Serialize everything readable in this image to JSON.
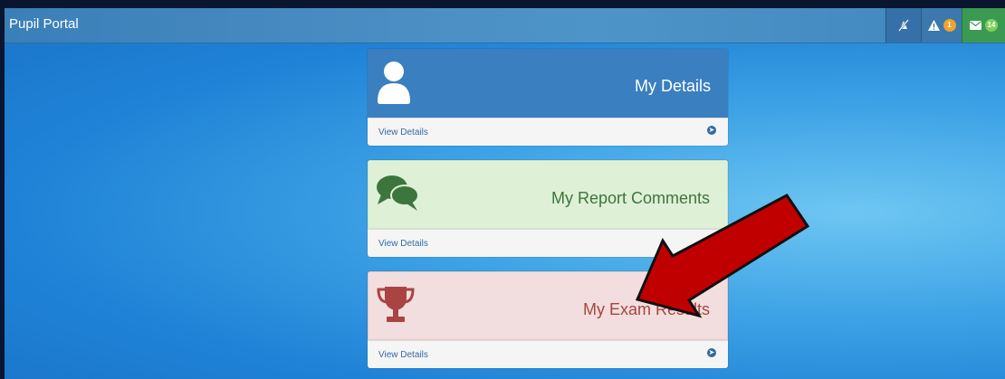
{
  "header": {
    "brand": "Pupil Portal",
    "alerts_count": "1",
    "messages_count": "14"
  },
  "panels": [
    {
      "title": "My Details",
      "link": "View Details",
      "icon": "user-icon",
      "color": "#3a7fc0"
    },
    {
      "title": "My Report Comments",
      "link": "View Details",
      "icon": "comments-icon",
      "color": "#def0d6"
    },
    {
      "title": "My Exam Results",
      "link": "View Details",
      "icon": "trophy-icon",
      "color": "#f2dede"
    }
  ],
  "colors": {
    "annotation_arrow": "#c00000",
    "messages_green": "#3a9a52",
    "badge_orange": "#f0a32c"
  }
}
